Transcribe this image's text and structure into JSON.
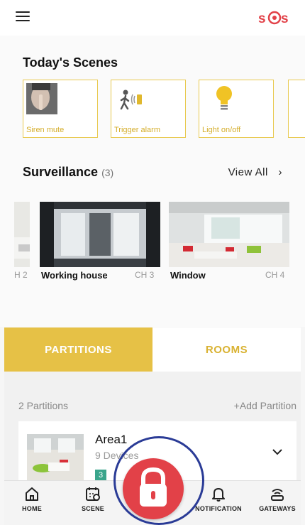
{
  "header": {
    "menu_icon": "hamburger-menu-icon",
    "logo_text": "SOS"
  },
  "scenes": {
    "title": "Today's Scenes",
    "items": [
      {
        "label": "Siren mute",
        "icon": "shush-photo"
      },
      {
        "label": "Trigger alarm",
        "icon": "walking-person-alarm-icon"
      },
      {
        "label": "Light on/off",
        "icon": "lightbulb-icon"
      }
    ]
  },
  "surveillance": {
    "title": "Surveillance",
    "count": "(3)",
    "view_all": "View All",
    "view_all_arrow": "›",
    "cameras": [
      {
        "name": "",
        "channel": "H 2"
      },
      {
        "name": "Working house",
        "channel": "CH 3"
      },
      {
        "name": "Window",
        "channel": "CH 4"
      }
    ]
  },
  "tabs": {
    "partitions": "PARTITIONS",
    "rooms": "ROOMS",
    "active": "partitions"
  },
  "partitions": {
    "count_text": "2 Partitions",
    "add_text": "+Add Partition",
    "items": [
      {
        "name": "Area1",
        "devices": "9 Devices",
        "badge": "3"
      }
    ]
  },
  "bottom_nav": {
    "home": "HOME",
    "scene": "SCENE",
    "notification": "NOTIFICATION",
    "gateways": "GATEWAYS"
  },
  "colors": {
    "accent": "#e6c146",
    "panic": "#e24148",
    "highlight": "#2a3b96",
    "badge": "#3aa58c"
  }
}
